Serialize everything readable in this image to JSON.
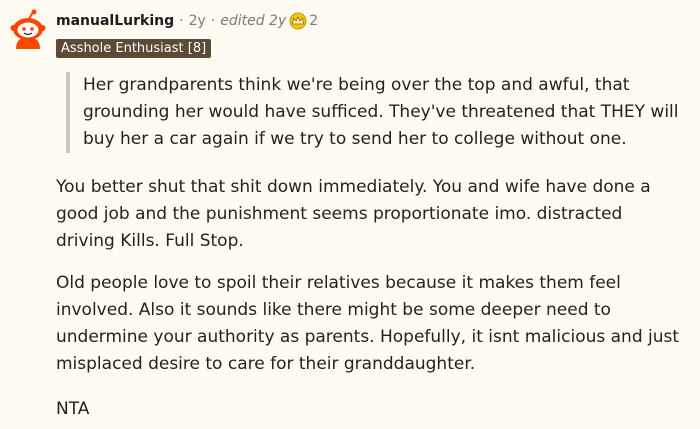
{
  "comment": {
    "username": "manualLurking",
    "age": "2y",
    "edited": "edited 2y",
    "award_icon": "gold-award-icon",
    "award_count": "2",
    "flair": "Asshole Enthusiast [8]",
    "quote": "Her grandparents think we're being over the top and awful, that grounding her would have sufficed. They've threatened that THEY will buy her a car again if we try to send her to college without one.",
    "paragraphs": [
      "You better shut that shit down immediately. You and wife have done a good job and the punishment seems proportionate imo. distracted driving Kills. Full Stop.",
      "Old people love to spoil their relatives because it makes them feel involved. Also it sounds like there might be some deeper need to undermine your authority as parents. Hopefully, it isnt malicious and just misplaced desire to care for their granddaughter.",
      "NTA"
    ],
    "colors": {
      "background": "#fdfbf2",
      "flair_bg": "#5b4a37",
      "avatar_orange": "#ff4500",
      "quote_bar": "#c8c8c8",
      "muted_text": "#7c7c7c"
    }
  }
}
